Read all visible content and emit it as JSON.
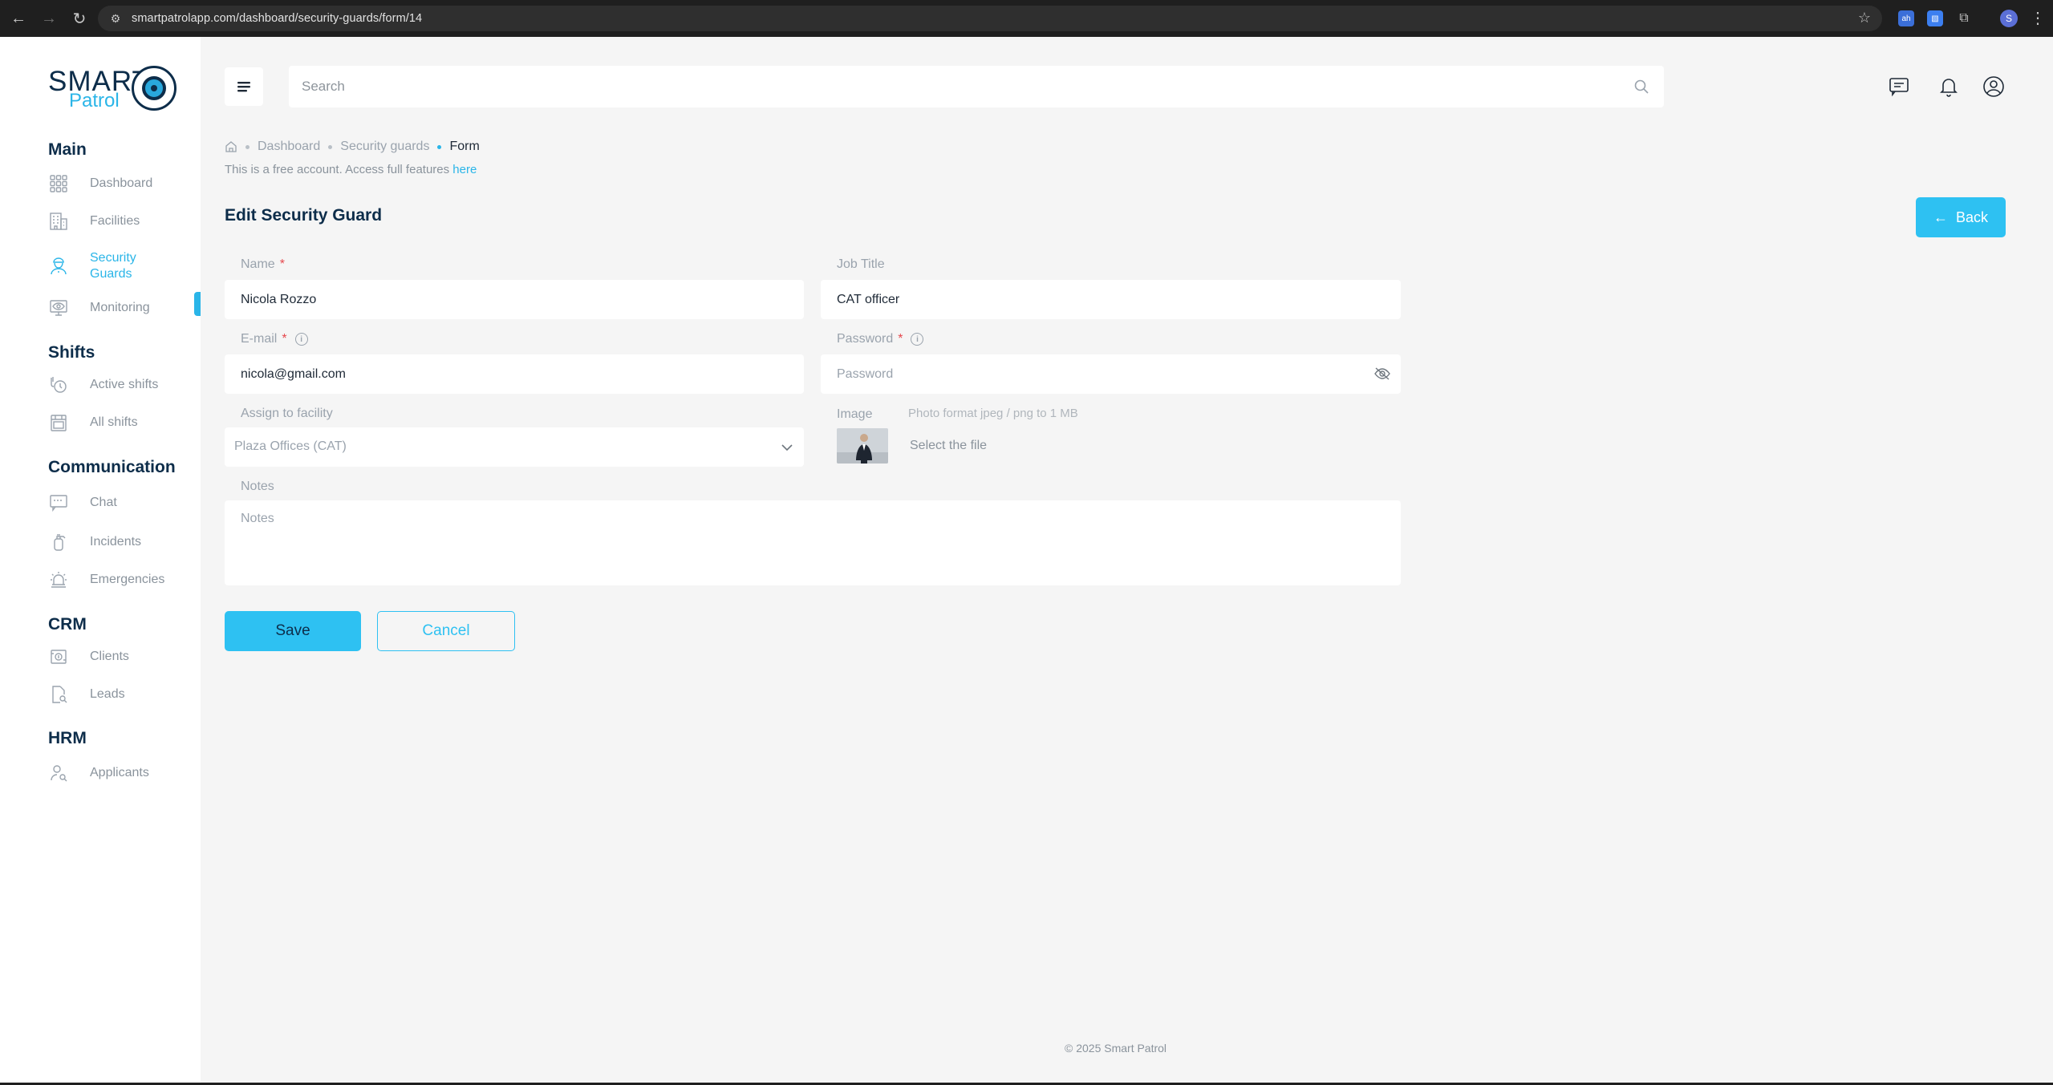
{
  "browser": {
    "url": "smartpatrolapp.com/dashboard/security-guards/form/14",
    "profile_initial": "S",
    "ext_label": "ah"
  },
  "logo": {
    "line1": "SMART",
    "line2": "Patrol"
  },
  "sidebar": {
    "sections": [
      {
        "title": "Main",
        "items": [
          {
            "label": "Dashboard",
            "icon": "grid-icon"
          },
          {
            "label": "Facilities",
            "icon": "building-icon"
          },
          {
            "label": "Security\nGuards",
            "icon": "guard-icon",
            "active": true
          },
          {
            "label": "Monitoring",
            "icon": "monitor-eye-icon"
          }
        ]
      },
      {
        "title": "Shifts",
        "items": [
          {
            "label": "Active shifts",
            "icon": "hand-timer-icon"
          },
          {
            "label": "All shifts",
            "icon": "calendar-icon"
          }
        ]
      },
      {
        "title": "Communication",
        "items": [
          {
            "label": "Chat",
            "icon": "chat-icon"
          },
          {
            "label": "Incidents",
            "icon": "extinguisher-icon"
          },
          {
            "label": "Emergencies",
            "icon": "siren-icon"
          }
        ]
      },
      {
        "title": "CRM",
        "items": [
          {
            "label": "Clients",
            "icon": "money-icon"
          },
          {
            "label": "Leads",
            "icon": "document-search-icon"
          }
        ]
      },
      {
        "title": "HRM",
        "items": [
          {
            "label": "Applicants",
            "icon": "user-search-icon"
          }
        ]
      }
    ]
  },
  "search": {
    "placeholder": "Search"
  },
  "breadcrumb": {
    "items": [
      "Dashboard",
      "Security guards"
    ],
    "current": "Form"
  },
  "notice": {
    "text": "This is a free account. Access full features ",
    "link": "here"
  },
  "page": {
    "title": "Edit Security Guard",
    "back_label": "Back"
  },
  "form": {
    "name": {
      "label": "Name",
      "required": "*",
      "value": "Nicola Rozzo"
    },
    "job_title": {
      "label": "Job Title",
      "value": "CAT officer"
    },
    "email": {
      "label": "E-mail",
      "required": "*",
      "value": "nicola@gmail.com"
    },
    "password": {
      "label": "Password",
      "required": "*",
      "placeholder": "Password"
    },
    "facility": {
      "label": "Assign to facility",
      "value": "Plaza Offices (CAT)"
    },
    "image": {
      "label": "Image",
      "hint": "Photo format jpeg / png to 1 MB",
      "select_text": "Select the file"
    },
    "notes": {
      "label": "Notes",
      "placeholder": "Notes"
    },
    "save_label": "Save",
    "cancel_label": "Cancel"
  },
  "footer": {
    "text": "© 2025 Smart Patrol"
  },
  "colors": {
    "accent": "#2ec1f2",
    "navy": "#0d2d4a",
    "required": "#e5484d"
  }
}
